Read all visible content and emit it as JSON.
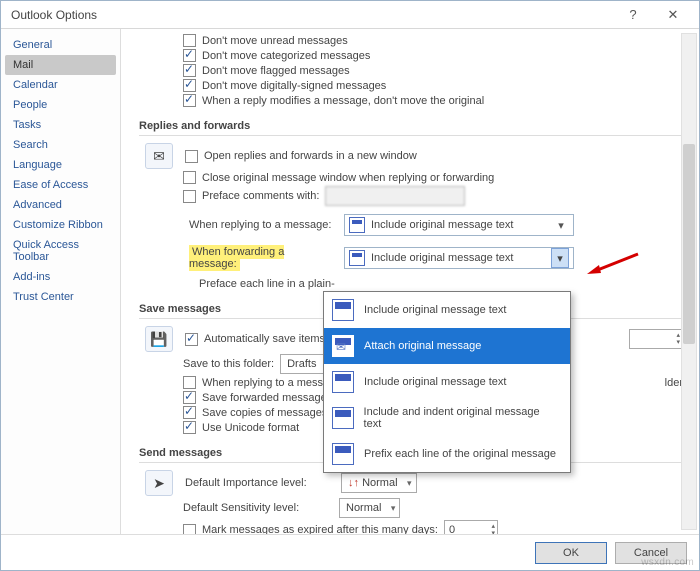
{
  "titlebar": {
    "title": "Outlook Options",
    "help": "?",
    "close": "✕"
  },
  "sidebar": {
    "items": [
      "General",
      "Mail",
      "Calendar",
      "People",
      "Tasks",
      "Search",
      "Language",
      "Ease of Access",
      "Advanced",
      "Customize Ribbon",
      "Quick Access Toolbar",
      "Add-ins",
      "Trust Center"
    ],
    "selected_index": 1
  },
  "top_checks": [
    {
      "checked": false,
      "label": "Don't move unread messages",
      "u": "u"
    },
    {
      "checked": true,
      "label": "Don't move categorized messages",
      "u": "categorized"
    },
    {
      "checked": true,
      "label": "Don't move flagged messages",
      "u": "flagged"
    },
    {
      "checked": true,
      "label": "Don't move digitally-signed messages",
      "u": "digitally"
    },
    {
      "checked": true,
      "label": "When a reply modifies a message, don't move the original",
      "u": "m"
    }
  ],
  "sections": {
    "replies": "Replies and forwards",
    "save": "Save messages",
    "send": "Send messages"
  },
  "replies": {
    "open_new": {
      "checked": false,
      "label": "Open replies and forwards in a new window"
    },
    "close_orig": {
      "checked": false,
      "label": "Close original message window when replying or forwarding"
    },
    "preface": {
      "checked": false,
      "label": "Preface comments with:",
      "value": ""
    },
    "reply_label": "When replying to a message:",
    "reply_value": "Include original message text",
    "fwd_label": "When forwarding a message:",
    "fwd_value": "Include original message text",
    "preface_line": "Preface each line in a plain-"
  },
  "fwd_options": [
    "Include original message text",
    "Attach original message",
    "Include original message text",
    "Include and indent original message text",
    "Prefix each line of the original message"
  ],
  "save": {
    "auto": {
      "checked": true,
      "label": "Automatically save items th"
    },
    "folder_label": "Save to this folder:",
    "folder_value": "Drafts",
    "reply_folder": {
      "checked": false,
      "label": "When replying to a message",
      "tail": "lder"
    },
    "save_fwd": {
      "checked": true,
      "label": "Save forwarded messages"
    },
    "save_copies": {
      "checked": true,
      "label": "Save copies of messages in"
    },
    "unicode": {
      "checked": true,
      "label": "Use Unicode format"
    }
  },
  "send": {
    "importance_label": "Default Importance level:",
    "importance_value": "Normal",
    "sensitivity_label": "Default Sensitivity level:",
    "sensitivity_value": "Normal",
    "expire": {
      "checked": false,
      "label": "Mark messages as expired after this many days:",
      "value": "0"
    }
  },
  "footer": {
    "ok": "OK",
    "cancel": "Cancel"
  },
  "watermark": "wsxdn.com"
}
